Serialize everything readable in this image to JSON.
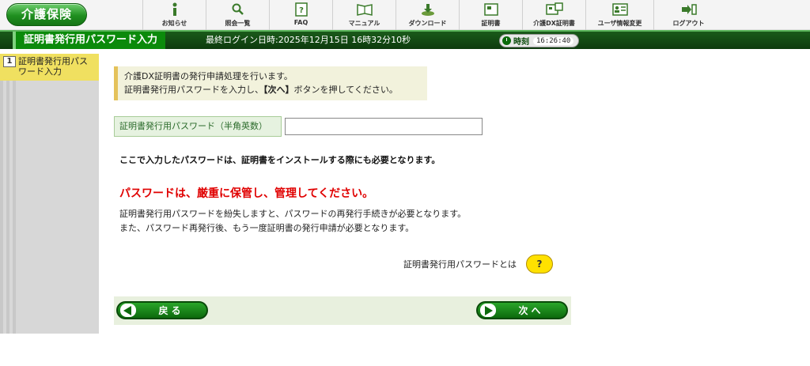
{
  "header": {
    "logo": "介護保険",
    "nav": [
      {
        "label": "お知らせ",
        "icon": "info-icon"
      },
      {
        "label": "照会一覧",
        "icon": "search-icon"
      },
      {
        "label": "FAQ",
        "icon": "faq-icon"
      },
      {
        "label": "マニュアル",
        "icon": "manual-icon"
      },
      {
        "label": "ダウンロード",
        "icon": "download-icon"
      },
      {
        "label": "証明書",
        "icon": "certificate-icon"
      },
      {
        "label": "介護DX証明書",
        "icon": "dx-certificate-icon"
      },
      {
        "label": "ユーザ情報変更",
        "icon": "user-info-icon"
      },
      {
        "label": "ログアウト",
        "icon": "logout-icon"
      }
    ]
  },
  "titlebar": {
    "title": "証明書発行用パスワード入力",
    "last_login": "最終ログイン日時:2025年12月15日 16時32分10秒",
    "clock_label": "時刻",
    "clock_time": "16:26:40"
  },
  "sidebar": {
    "steps": [
      {
        "number": "1",
        "label": "証明書発行用パスワード入力"
      }
    ]
  },
  "main": {
    "notice_line1": "介護DX証明書の発行申請処理を行います。",
    "notice_line2_pre": "証明書発行用パスワードを入力し、",
    "notice_line2_bold": "【次へ】",
    "notice_line2_post": "ボタンを押してください。",
    "password_label": "証明書発行用パスワード（半角英数）",
    "password_value": "",
    "bold_note": "ここで入力したパスワードは、証明書をインストールする際にも必要となります。",
    "red_heading": "パスワードは、厳重に保管し、管理してください。",
    "desc_line1": "証明書発行用パスワードを紛失しますと、パスワードの再発行手続きが必要となります。",
    "desc_line2": "また、パスワード再発行後、もう一度証明書の発行申請が必要となります。",
    "help_text": "証明書発行用パスワードとは",
    "help_button": "?",
    "back_label": "戻る",
    "next_label": "次へ"
  },
  "colors": {
    "brand_green": "#0b8a0b",
    "sidebar_active": "#f0e060",
    "alert_red": "#e00000",
    "help_yellow": "#ffe100"
  }
}
